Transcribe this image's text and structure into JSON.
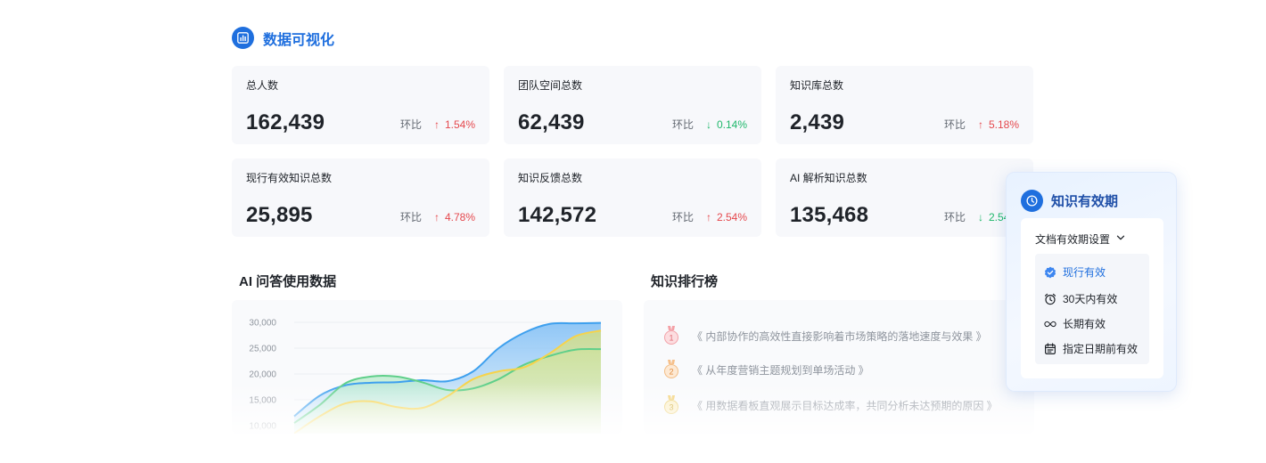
{
  "section": {
    "title": "数据可视化",
    "icon": "bar-chart-icon"
  },
  "stats": [
    {
      "label": "总人数",
      "value": "162,439",
      "change_label": "环比",
      "change": "1.54%",
      "direction": "up"
    },
    {
      "label": "团队空间总数",
      "value": "62,439",
      "change_label": "环比",
      "change": "0.14%",
      "direction": "down"
    },
    {
      "label": "知识库总数",
      "value": "2,439",
      "change_label": "环比",
      "change": "5.18%",
      "direction": "up"
    },
    {
      "label": "现行有效知识总数",
      "value": "25,895",
      "change_label": "环比",
      "change": "4.78%",
      "direction": "up"
    },
    {
      "label": "知识反馈总数",
      "value": "142,572",
      "change_label": "环比",
      "change": "2.54%",
      "direction": "up"
    },
    {
      "label": "AI 解析知识总数",
      "value": "135,468",
      "change_label": "环比",
      "change": "2.54%",
      "direction": "down"
    }
  ],
  "colors": {
    "accent": "#1f6fde",
    "up": "#e5484d",
    "down": "#1fb86b"
  },
  "ai_chart": {
    "title": "AI 问答使用数据",
    "chart_data": {
      "type": "area",
      "yticks": [
        "30,000",
        "25,000",
        "20,000",
        "15,000",
        "10,000"
      ],
      "ylim": [
        10000,
        30000
      ],
      "x": [
        0,
        1,
        2,
        3,
        4,
        5,
        6,
        7,
        8,
        9,
        10,
        11,
        12
      ],
      "series": [
        {
          "color": "#3ea0ee",
          "values": [
            11800,
            15800,
            17800,
            18300,
            18400,
            18800,
            18600,
            20500,
            25000,
            28000,
            29700,
            29800,
            29900
          ]
        },
        {
          "color": "#5fcf8a",
          "values": [
            10500,
            14000,
            18200,
            19500,
            19500,
            18400,
            16900,
            17200,
            19000,
            21800,
            23500,
            24700,
            24800
          ]
        },
        {
          "color": "#f7d34a",
          "values": [
            8500,
            11800,
            14300,
            14700,
            13600,
            13400,
            15700,
            19000,
            20500,
            21300,
            24000,
            27300,
            28400
          ]
        }
      ]
    }
  },
  "ranking": {
    "title": "知识排行榜",
    "items": [
      {
        "rank": "1",
        "text": "《 内部协作的高效性直接影响着市场策略的落地速度与效果 》"
      },
      {
        "rank": "2",
        "text": "《 从年度营销主题规划到单场活动 》"
      },
      {
        "rank": "3",
        "text": "《 用数据看板直观展示目标达成率，共同分析未达预期的原因 》"
      }
    ]
  },
  "validity_popup": {
    "title": "知识有效期",
    "dropdown_label": "文档有效期设置",
    "options": [
      {
        "label": "现行有效",
        "icon": "check-badge-icon",
        "selected": true
      },
      {
        "label": "30天内有效",
        "icon": "alarm-clock-icon",
        "selected": false
      },
      {
        "label": "长期有效",
        "icon": "infinity-icon",
        "selected": false
      },
      {
        "label": "指定日期前有效",
        "icon": "calendar-icon",
        "selected": false
      }
    ]
  }
}
